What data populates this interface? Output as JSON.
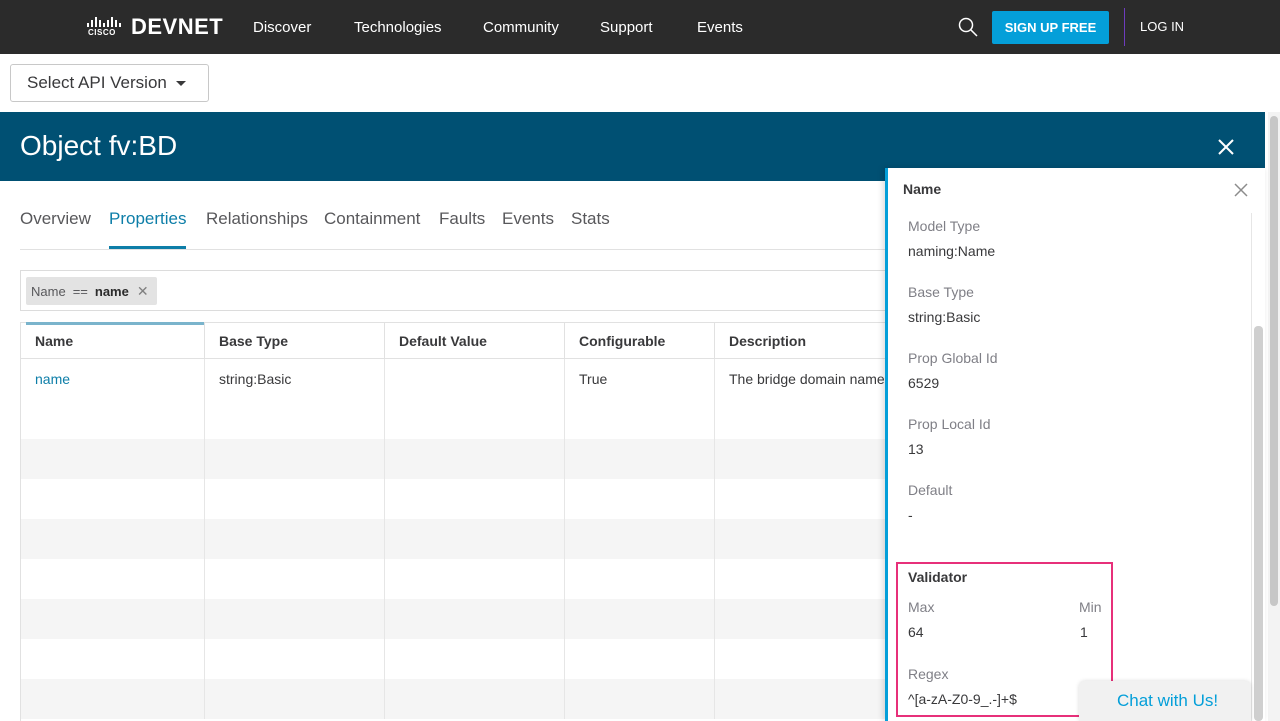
{
  "nav": {
    "brand_small": "CISCO",
    "brand_main": "DEVNET",
    "links": [
      "Discover",
      "Technologies",
      "Community",
      "Support",
      "Events"
    ],
    "signup_label": "SIGN UP FREE",
    "login_label": "LOG IN",
    "accent_color": "#049fd9"
  },
  "version_select": {
    "label": "Select API Version"
  },
  "object": {
    "title": "Object fv:BD"
  },
  "tabs": [
    "Overview",
    "Properties",
    "Relationships",
    "Containment",
    "Faults",
    "Events",
    "Stats"
  ],
  "active_tab": "Properties",
  "filter": {
    "field": "Name",
    "operator": "==",
    "value": "name"
  },
  "table": {
    "columns": [
      "Name",
      "Base Type",
      "Default Value",
      "Configurable",
      "Description"
    ],
    "rows": [
      {
        "name": "name",
        "base_type": "string:Basic",
        "default_value": "",
        "configurable": "True",
        "description": "The bridge domain name"
      }
    ]
  },
  "panel": {
    "title": "Name",
    "fields": [
      {
        "label": "Model Type",
        "value": "naming:Name"
      },
      {
        "label": "Base Type",
        "value": "string:Basic"
      },
      {
        "label": "Prop Global Id",
        "value": "6529"
      },
      {
        "label": "Prop Local Id",
        "value": "13"
      },
      {
        "label": "Default",
        "value": "-"
      }
    ],
    "validator": {
      "heading": "Validator",
      "max_label": "Max",
      "max_value": "64",
      "min_label": "Min",
      "min_value": "1",
      "regex_label": "Regex",
      "regex_value": "^[a-zA-Z0-9_.-]+$",
      "highlight_color": "#e7307a"
    }
  },
  "chat": {
    "label": "Chat with Us!"
  }
}
